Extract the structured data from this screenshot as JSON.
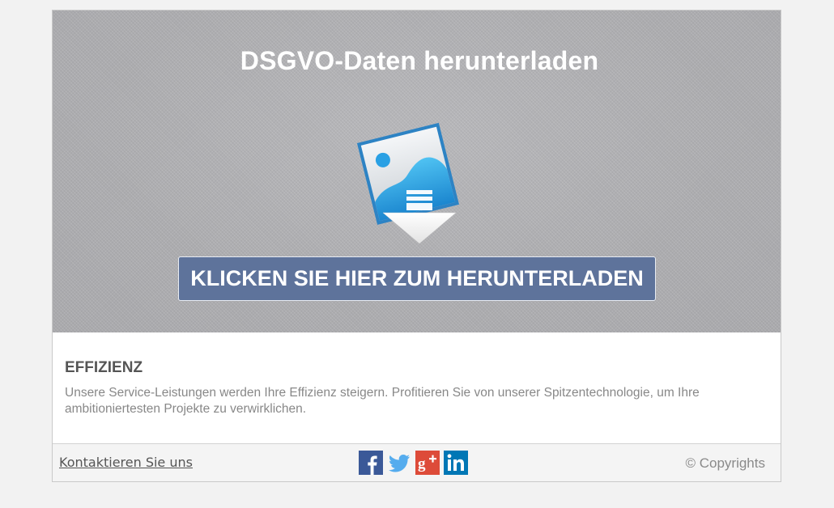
{
  "hero": {
    "title": "DSGVO-Daten herunterladen",
    "icon": "image-download-icon",
    "download_button_label": "KLICKEN SIE HIER ZUM HERUNTERLADEN"
  },
  "content": {
    "heading": "EFFIZIENZ",
    "text": "Unsere Service-Leistungen werden Ihre Effizienz steigern. Profitieren Sie von unserer Spitzentechnologie, um Ihre ambitioniertesten Projekte zu verwirklichen."
  },
  "footer": {
    "contact_label": "Kontaktieren Sie uns",
    "social_icons": [
      "facebook-icon",
      "twitter-icon",
      "google-plus-icon",
      "linkedin-icon"
    ],
    "copyright": "© Copyrights"
  },
  "colors": {
    "button_background": "#5e739b",
    "hero_background": "#b3b3b6",
    "facebook": "#3b5998",
    "twitter": "#55acee",
    "google_plus": "#dd4b39",
    "linkedin": "#0077b5"
  }
}
